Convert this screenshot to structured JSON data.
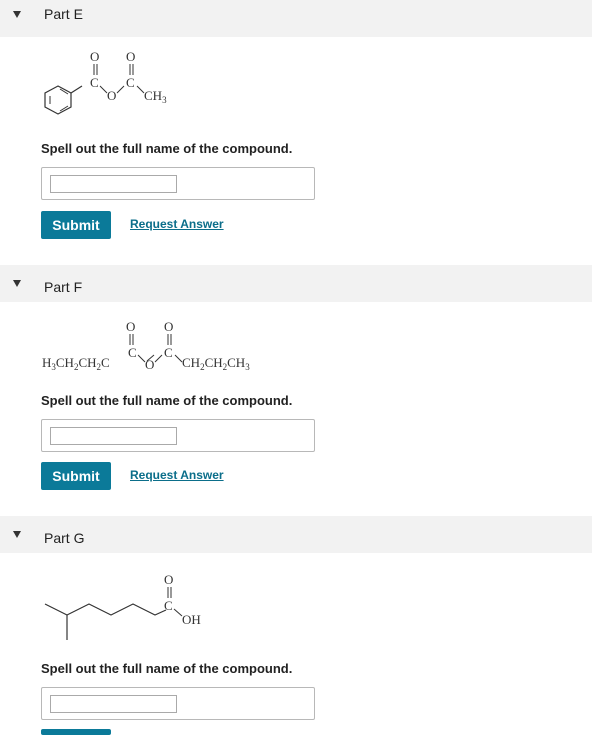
{
  "parts": [
    {
      "title": "Part E",
      "prompt": "Spell out the full name of the compound.",
      "input_value": "",
      "submit_label": "Submit",
      "request_label": "Request Answer",
      "molecule": {
        "o1": "O",
        "o2": "O",
        "c1": "C",
        "c2": "C",
        "o_bridge": "O",
        "ch3": "CH3"
      }
    },
    {
      "title": "Part F",
      "prompt": "Spell out the full name of the compound.",
      "input_value": "",
      "submit_label": "Submit",
      "request_label": "Request Answer",
      "molecule": {
        "o1": "O",
        "o2": "O",
        "c1": "C",
        "c2": "C",
        "o_bridge": "O",
        "left_group": "H3CH2CH2C",
        "right_group": "CH2CH2CH3"
      }
    },
    {
      "title": "Part G",
      "prompt": "Spell out the full name of the compound.",
      "input_value": "",
      "molecule": {
        "o": "O",
        "c": "C",
        "oh": "OH"
      }
    }
  ],
  "colors": {
    "header_bg": "#f2f2f2",
    "button_bg": "#0b7a99",
    "link": "#0b6e8a"
  },
  "icons": {
    "expand": "triangle-down-icon"
  }
}
